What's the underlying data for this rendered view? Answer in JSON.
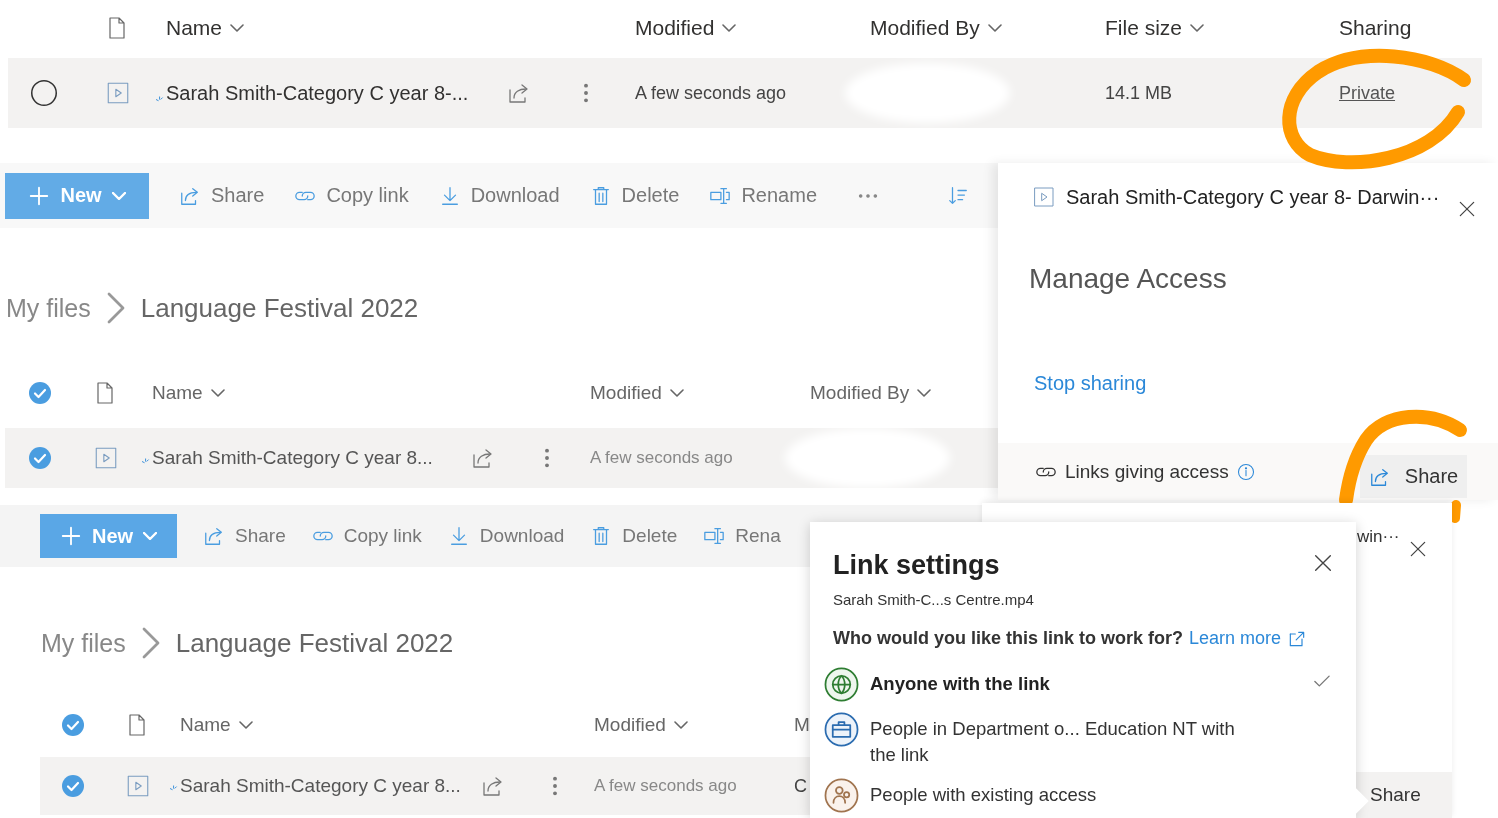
{
  "top_list": {
    "columns": [
      {
        "label": "Name",
        "has_menu": true
      },
      {
        "label": "Modified",
        "has_menu": true
      },
      {
        "label": "Modified By",
        "has_menu": true
      },
      {
        "label": "File size",
        "has_menu": true
      },
      {
        "label": "Sharing",
        "has_menu": false
      }
    ],
    "row": {
      "selected": false,
      "name": "Sarah Smith-Category C year 8-...",
      "modified": "A few seconds ago",
      "extra": [
        {
          "kind": "redacted"
        },
        {
          "kind": "text",
          "text": "14.1 MB"
        },
        {
          "kind": "link",
          "text": "Private"
        }
      ]
    }
  },
  "list_1": {
    "toolbar": {
      "new": "New",
      "actions": [
        {
          "kind": "share",
          "label": "Share"
        },
        {
          "kind": "link",
          "label": "Copy link"
        },
        {
          "kind": "download",
          "label": "Download"
        },
        {
          "kind": "delete",
          "label": "Delete"
        },
        {
          "kind": "rename",
          "label": "Rename"
        },
        {
          "kind": "more"
        },
        {
          "kind": "sort"
        }
      ]
    },
    "breadcrumb": [
      "My files",
      "Language Festival 2022"
    ],
    "header_checked": true,
    "columns": [
      {
        "label": "Name",
        "has_menu": true
      },
      {
        "label": "Modified",
        "has_menu": true
      },
      {
        "label": "Modified By",
        "has_menu": true
      }
    ],
    "row": {
      "selected": true,
      "name": "Sarah Smith-Category C year 8...",
      "modified": "A few seconds ago",
      "extra": [
        {
          "kind": "redacted"
        }
      ]
    }
  },
  "manage_access": {
    "file_name": "Sarah Smith-Category C year 8- Darwin···",
    "title": "Manage Access",
    "stop_sharing": "Stop sharing",
    "links_label": "Links giving access",
    "share": "Share"
  },
  "list_2": {
    "toolbar": {
      "new": "New",
      "actions": [
        {
          "kind": "share",
          "label": "Share"
        },
        {
          "kind": "link",
          "label": "Copy link"
        },
        {
          "kind": "download",
          "label": "Download"
        },
        {
          "kind": "delete",
          "label": "Delete"
        },
        {
          "kind": "rename",
          "label": "Rena"
        }
      ]
    },
    "breadcrumb": [
      "My files",
      "Language Festival 2022"
    ],
    "header_checked": true,
    "columns": [
      {
        "label": "Name",
        "has_menu": true
      },
      {
        "label": "Modified",
        "has_menu": true
      },
      {
        "label": "M",
        "has_menu": false
      }
    ],
    "row": {
      "selected": true,
      "name": "Sarah Smith-Category C year 8...",
      "modified": "A few seconds ago",
      "extra": [
        {
          "kind": "text",
          "text": "C"
        }
      ]
    }
  },
  "manage_access_2": {
    "file_name": "win···",
    "share": "Share"
  },
  "link_settings": {
    "title": "Link settings",
    "file_name": "Sarah Smith-C...s Centre.mp4",
    "question": "Who would you like this link to work for?",
    "learn_more": "Learn more",
    "options": [
      {
        "kind": "anyone",
        "label": "Anyone with the link",
        "selected": true
      },
      {
        "kind": "organization",
        "label": "People in Department o... Education NT with the link",
        "selected": false
      },
      {
        "kind": "existing",
        "label": "People with existing access",
        "selected": false
      }
    ]
  }
}
